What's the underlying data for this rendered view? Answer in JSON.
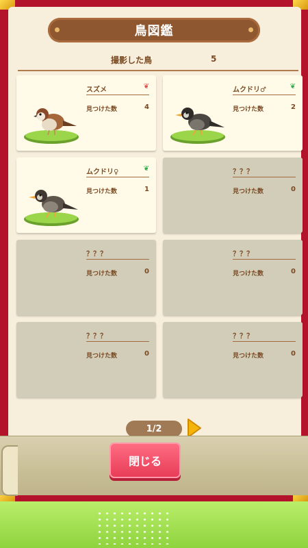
{
  "header": {
    "title": "鳥図鑑"
  },
  "summary": {
    "label": "撮影した鳥",
    "count": "5"
  },
  "cards": [
    {
      "name": "スズメ",
      "found_label": "見つけた数",
      "count": "4",
      "leaf_color": "#e24b4b",
      "state": "found"
    },
    {
      "name": "ムクドリ♂",
      "found_label": "見つけた数",
      "count": "2",
      "leaf_color": "#2ea84a",
      "state": "found"
    },
    {
      "name": "ムクドリ♀",
      "found_label": "見つけた数",
      "count": "1",
      "leaf_color": "#2ea84a",
      "state": "found"
    },
    {
      "name": "？？？",
      "found_label": "見つけた数",
      "count": "0",
      "state": "empty"
    },
    {
      "name": "？？？",
      "found_label": "見つけた数",
      "count": "0",
      "state": "empty"
    },
    {
      "name": "？？？",
      "found_label": "見つけた数",
      "count": "0",
      "state": "empty"
    },
    {
      "name": "？？？",
      "found_label": "見つけた数",
      "count": "0",
      "state": "empty"
    },
    {
      "name": "？？？",
      "found_label": "見つけた数",
      "count": "0",
      "state": "empty"
    }
  ],
  "pager": {
    "label": "1/2",
    "next_icon": "next-page-arrow-icon"
  },
  "footer": {
    "close_label": "閉じる"
  },
  "colors": {
    "cover": "#b3132b",
    "page": "#f7efdc",
    "title_bar": "#8e5730",
    "close_button": "#e73b56"
  }
}
